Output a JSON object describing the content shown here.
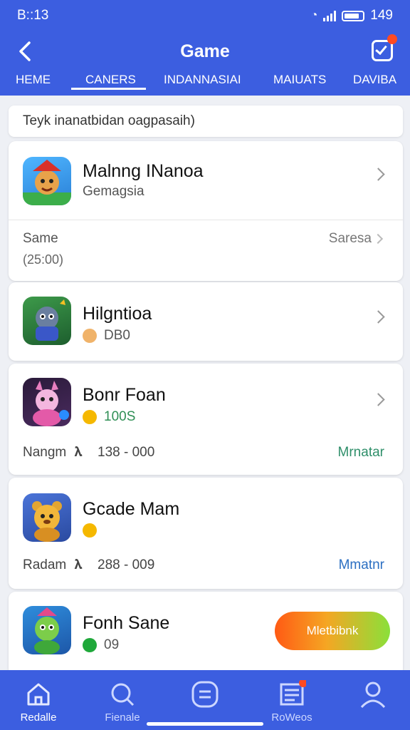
{
  "status": {
    "time": "B::13",
    "battery": "149"
  },
  "header": {
    "title": "Game",
    "back_icon": "chevron-left-icon",
    "action_icon": "check-square-icon"
  },
  "tabs": [
    {
      "label": "HEME"
    },
    {
      "label": "CANERS",
      "active": true
    },
    {
      "label": "INDANNASIAI"
    },
    {
      "label": "MAIUATS"
    },
    {
      "label": "DAVIBA"
    }
  ],
  "search": {
    "text": "Teyk inanatbidan oagpasaih)"
  },
  "cards": [
    {
      "name": "Malnng INanoa",
      "subtitle": "Gemagsia",
      "footer_left": "Same",
      "footer_left2": "(25:00)",
      "footer_right": "Saresa"
    },
    {
      "name": "Hilgntioa",
      "stat": "DB0"
    },
    {
      "name": "Bonr Foan",
      "stat": "100S",
      "footer_label": "Nangm",
      "footer_value": "138 - 000",
      "footer_right": "Mrnatar"
    },
    {
      "name": "Gcade Mam",
      "footer_label": "Radam",
      "footer_value": "288 - 009",
      "footer_right": "Mmatnr"
    },
    {
      "name": "Fonh Sane",
      "stat": "09",
      "button": "Mletbibnk"
    }
  ],
  "bottom_nav": [
    {
      "label": "Redalle",
      "icon": "home-icon"
    },
    {
      "label": "Fienale",
      "icon": "search-icon"
    },
    {
      "label": "",
      "icon": "list-icon"
    },
    {
      "label": "RoWeos",
      "icon": "news-icon"
    },
    {
      "label": "",
      "icon": "profile-icon"
    }
  ],
  "colors": {
    "primary": "#3c5ee0",
    "green": "#2f8f55",
    "blue_text": "#2b6fc2",
    "coin": "#f5a623"
  }
}
